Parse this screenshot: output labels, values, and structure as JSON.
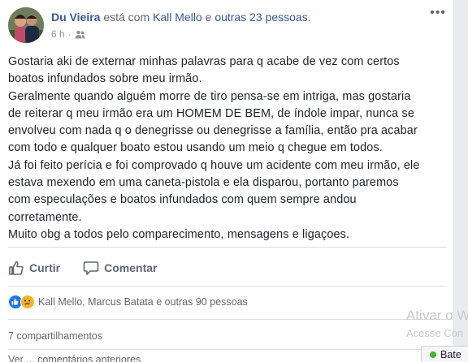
{
  "post": {
    "author": "Du Vieira",
    "connector": "está com",
    "tagged_person": "Kall Mello",
    "and_word": "e",
    "others": "outras 23 pessoas",
    "period": ".",
    "time": "6 h",
    "separator": "·",
    "audience_icon": "friends-icon",
    "options_icon": "more-options-icon",
    "body_lines": [
      "Gostaria aki de externar minhas palavras para q acabe de vez com certos",
      "boatos infundados sobre meu irmão.",
      "Geralmente quando alguém morre de tiro pensa-se em intriga, mas gostaria",
      "de reiterar q meu irmão era um HOMEM DE BEM, de índole impar, nunca se",
      "envolveu com nada q o denegrisse ou denegrisse a família, então pra acabar",
      "com todo e qualquer boato estou usando um meio q chegue em todos.",
      "Já foi feito perícia e foi comprovado q houve um acidente com meu irmão, ele",
      "estava mexendo em uma caneta-pistola e ela disparou, portanto paremos",
      "com especulações e boatos infundados com quem sempre andou",
      "corretamente.",
      "Muito obg a todos pelo comparecimento, mensagens e ligaçoes."
    ]
  },
  "actions": {
    "like_label": "Curtir",
    "comment_label": "Comentar"
  },
  "reactions": {
    "types": [
      "like",
      "sad"
    ],
    "summary": "Kall Mello, Marcus Batata e outras 90 pessoas"
  },
  "shares": {
    "label": "7 compartilhamentos"
  },
  "comments_cut": {
    "label": "Ver ... comentários anteriores"
  },
  "watermark": {
    "line1": "Ativar o W",
    "line2": "Acesse Con"
  },
  "chat": {
    "label": "Bate"
  },
  "colors": {
    "link": "#385898",
    "like_blue": "#1877f2",
    "sad_yellow": "#f7b125",
    "online_green": "#42b72a"
  }
}
